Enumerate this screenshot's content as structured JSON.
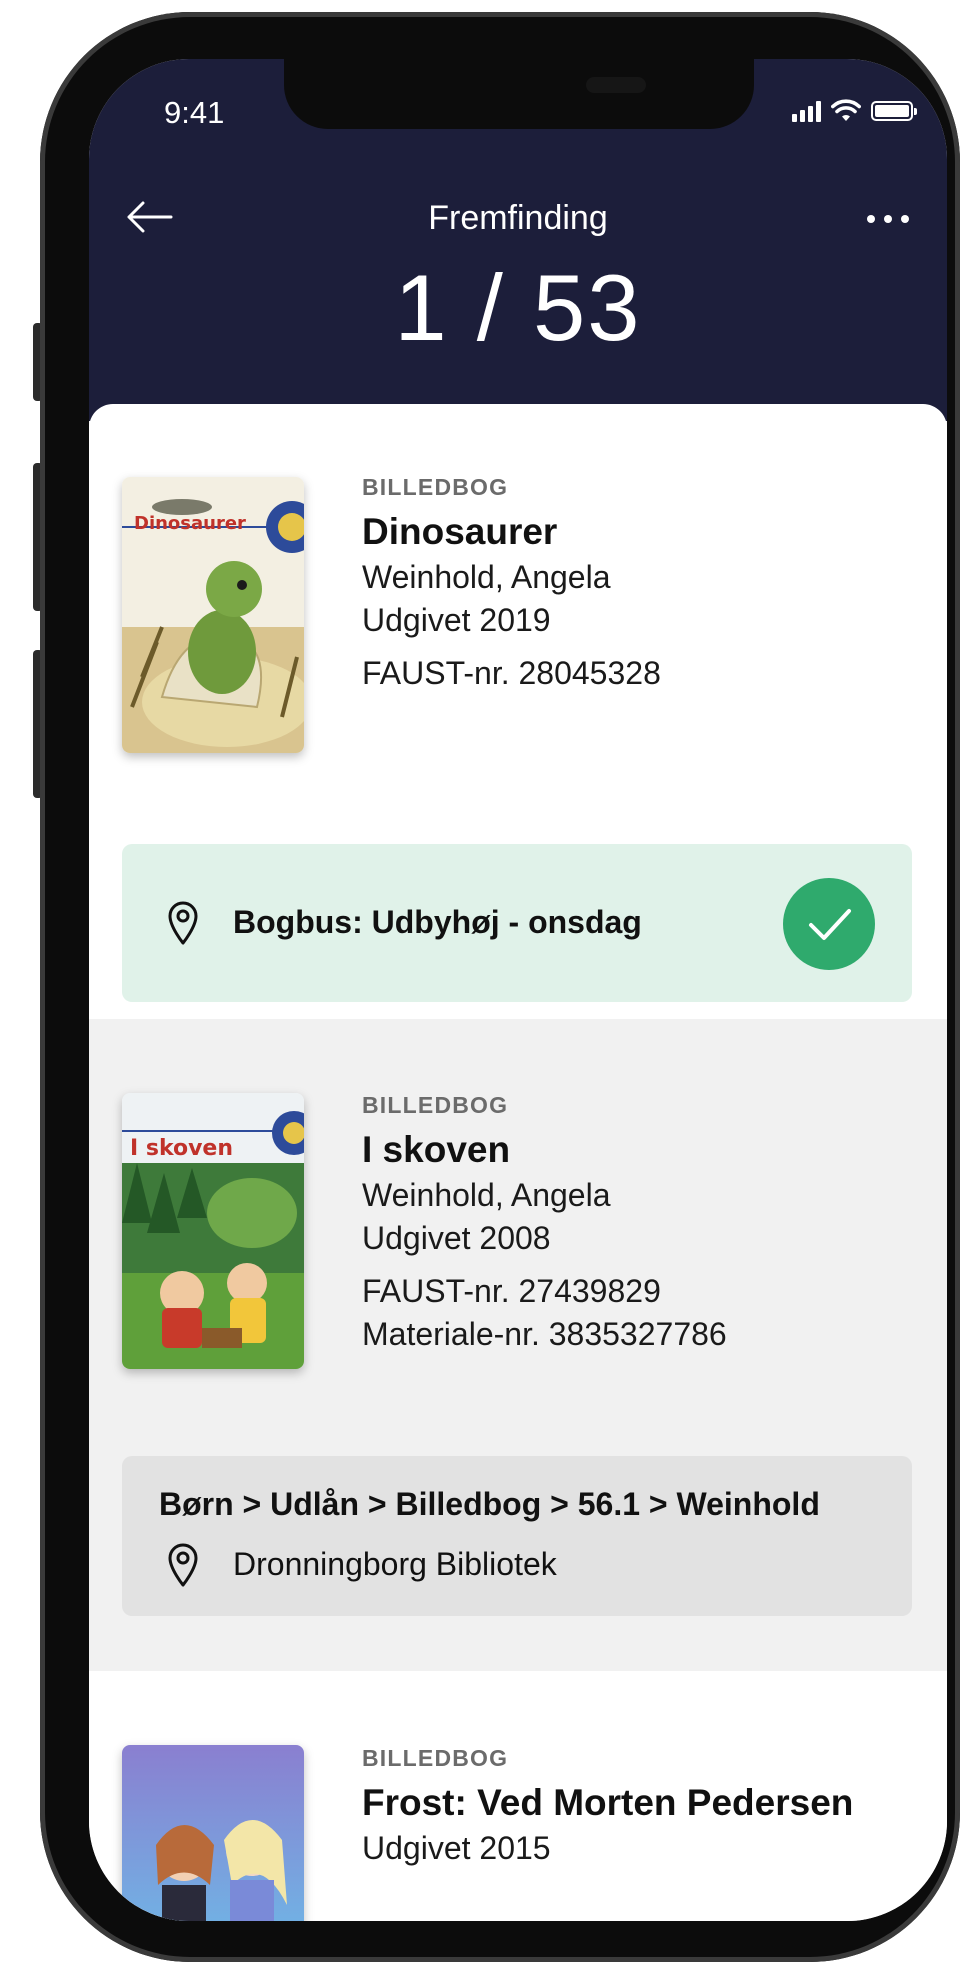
{
  "status_bar": {
    "time": "9:41"
  },
  "header": {
    "back_icon": "arrow-left-icon",
    "title": "Fremfinding",
    "more_icon": "ellipsis-icon",
    "counter": "1 / 53"
  },
  "colors": {
    "header_bg": "#1c1e3a",
    "success": "#2faa6d",
    "success_bg": "#e0f2e9"
  },
  "items": [
    {
      "category": "BILLEDBOG",
      "title": "Dinosaurer",
      "author": "Weinhold, Angela",
      "published": "Udgivet 2019",
      "faust": "FAUST-nr. 28045328",
      "cover_text": "Dinosaurer",
      "location": "Bogbus: Udbyhøj - onsdag",
      "location_icon": "map-pin-icon",
      "status_icon": "checkmark-icon"
    },
    {
      "category": "BILLEDBOG",
      "title": "I skoven",
      "author": "Weinhold, Angela",
      "published": "Udgivet 2008",
      "faust": "FAUST-nr. 27439829",
      "material": "Materiale-nr. 3835327786",
      "cover_text": "I skoven",
      "shelf_path": "Børn > Udlån > Billedbog > 56.1 > Weinhold",
      "location": "Dronningborg Bibliotek",
      "location_icon": "map-pin-icon"
    },
    {
      "category": "BILLEDBOG",
      "title": "Frost: Ved Morten Pedersen",
      "published": "Udgivet 2015"
    }
  ]
}
